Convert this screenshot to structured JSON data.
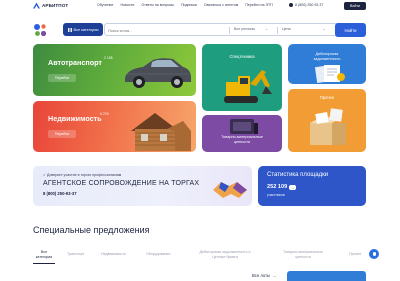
{
  "header": {
    "logo_text": "АРБИТПОТ",
    "nav": [
      "Обучение",
      "Новости",
      "Ответы на вопросы",
      "Подписки",
      "Связаться с агентом",
      "Перейти на ЭТП"
    ],
    "phone": "8 (800) 250 93 37",
    "login_label": "Войти"
  },
  "search": {
    "categories_label": "Все категории",
    "placeholder": "Поиск котов...",
    "region_label": "Все регионы",
    "price_label": "Цена",
    "find_label": "Найти"
  },
  "cards": {
    "auto": {
      "title": "Автотранспорт",
      "count": "2 158",
      "button": "Перейти"
    },
    "estate": {
      "title": "Недвижимость",
      "count": "6 276",
      "button": "Перейти"
    },
    "special": {
      "title": "Спецтехника"
    },
    "debt": {
      "title_line1": "Дебиторская",
      "title_line2": "задолженность"
    },
    "goods": {
      "title_line1": "Товарно-материальные",
      "title_line2": "ценности"
    },
    "other": {
      "title": "Прочее"
    }
  },
  "banner": {
    "subtitle": "Доверьте участие в торгах профессионалам",
    "title": "АГЕНТСКОЕ СОПРОВОЖДЕНИЕ НА ТОРГАХ",
    "phone": "8 (800) 250-93-37"
  },
  "stats": {
    "title": "Статистика площадки",
    "value": "252 109",
    "label": "участников"
  },
  "offers": {
    "title": "Специальные предложения",
    "tabs": [
      {
        "line1": "Все",
        "line2": "категории",
        "active": true
      },
      {
        "line1": "Транспорт",
        "line2": ""
      },
      {
        "line1": "Недвижимость",
        "line2": ""
      },
      {
        "line1": "Оборудование",
        "line2": ""
      },
      {
        "line1": "Дебиторская задолженность и",
        "line2": "Ценные бумаги"
      },
      {
        "line1": "Товарно-материальные",
        "line2": "ценности"
      },
      {
        "line1": "Прочее",
        "line2": ""
      }
    ],
    "all_lots": "Все лоты"
  },
  "colors": {
    "brand_dark": "#1d2440",
    "accent_blue": "#2b5fd9",
    "auto_green": "#5eab3c",
    "estate_red": "#f06a47",
    "special_teal": "#1f9e7f",
    "debt_blue": "#2f7dd6",
    "goods_purple": "#7d4aa4",
    "other_orange": "#f19c34",
    "stats_blue": "#2f56c8"
  }
}
